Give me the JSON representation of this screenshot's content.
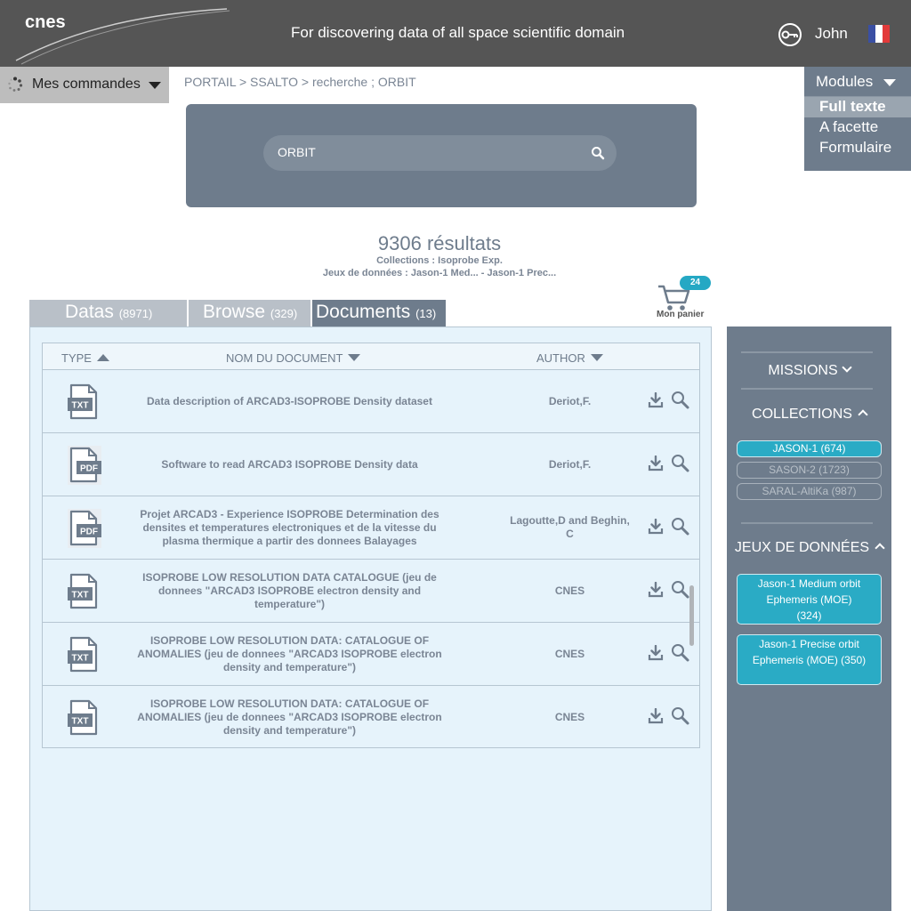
{
  "header": {
    "logo": "cnes",
    "tagline": "For discovering data of all space scientific domain",
    "user": "John",
    "flag_colors": [
      "#3a4fa3",
      "#ffffff",
      "#e23a3a"
    ]
  },
  "orders": {
    "label": "Mes commandes"
  },
  "breadcrumb": "PORTAIL > SSALTO > recherche ; ORBIT",
  "modules": {
    "label": "Modules",
    "items": [
      {
        "label": "Full texte",
        "active": true
      },
      {
        "label": "A facette",
        "active": false
      },
      {
        "label": "Formulaire",
        "active": false
      }
    ]
  },
  "search": {
    "value": "ORBIT"
  },
  "results": {
    "count": "9306 résultats",
    "collections": "Collections : Isoprobe Exp.",
    "datasets": "Jeux de données : Jason-1 Med... - Jason-1 Prec..."
  },
  "cart": {
    "count": "24",
    "label": "Mon panier"
  },
  "tabs": [
    {
      "label": "Datas",
      "count": "(8971)",
      "active": false
    },
    {
      "label": "Browse",
      "count": "(329)",
      "active": false
    },
    {
      "label": "Documents",
      "count": "(13)",
      "active": true
    }
  ],
  "table": {
    "col_type": "TYPE",
    "col_name": "NOM DU DOCUMENT",
    "col_author": "AUTHOR",
    "rows": [
      {
        "type": "TXT",
        "name": "Data description of ARCAD3-ISOPROBE Density dataset",
        "author": "Deriot,F."
      },
      {
        "type": "PDF",
        "name": "Software to read ARCAD3 ISOPROBE Density data",
        "author": "Deriot,F."
      },
      {
        "type": "PDF",
        "name": "Projet ARCAD3 - Experience ISOPROBE Determination des densites et temperatures electroniques et de la vitesse du plasma thermique a partir des donnees Balayages",
        "author": "Lagoutte,D and Beghin, C"
      },
      {
        "type": "TXT",
        "name": "ISOPROBE LOW RESOLUTION DATA CATALOGUE (jeu de donnees \"ARCAD3 ISOPROBE electron density and temperature\")",
        "author": "CNES"
      },
      {
        "type": "TXT",
        "name": "ISOPROBE LOW RESOLUTION DATA: CATALOGUE OF ANOMALIES (jeu de donnees \"ARCAD3 ISOPROBE electron density and temperature\")",
        "author": "CNES"
      },
      {
        "type": "TXT",
        "name": "ISOPROBE LOW RESOLUTION DATA: CATALOGUE OF ANOMALIES (jeu de donnees \"ARCAD3 ISOPROBE electron density and temperature\")",
        "author": "CNES"
      }
    ]
  },
  "facets": {
    "missions": "MISSIONS",
    "collections": "COLLECTIONS",
    "collection_items": [
      {
        "label": "JASON-1 (674)",
        "active": true
      },
      {
        "label": "SASON-2 (1723)",
        "active": false
      },
      {
        "label": "SARAL-AltiKa (987)",
        "active": false
      }
    ],
    "datasets": "JEUX DE DONNÉES",
    "dataset_items": [
      {
        "lines": [
          "Jason-1 Medium orbit",
          "Ephemeris (MOE)",
          "(324)"
        ]
      },
      {
        "lines": [
          "Jason-1 Precise orbit",
          "Ephemeris (MOE) (350)"
        ]
      }
    ]
  },
  "colors": {
    "header_bg": "#555555",
    "panel": "#6e7c8c",
    "accent": "#2aabc5",
    "content_bg": "#e6f3fb"
  }
}
